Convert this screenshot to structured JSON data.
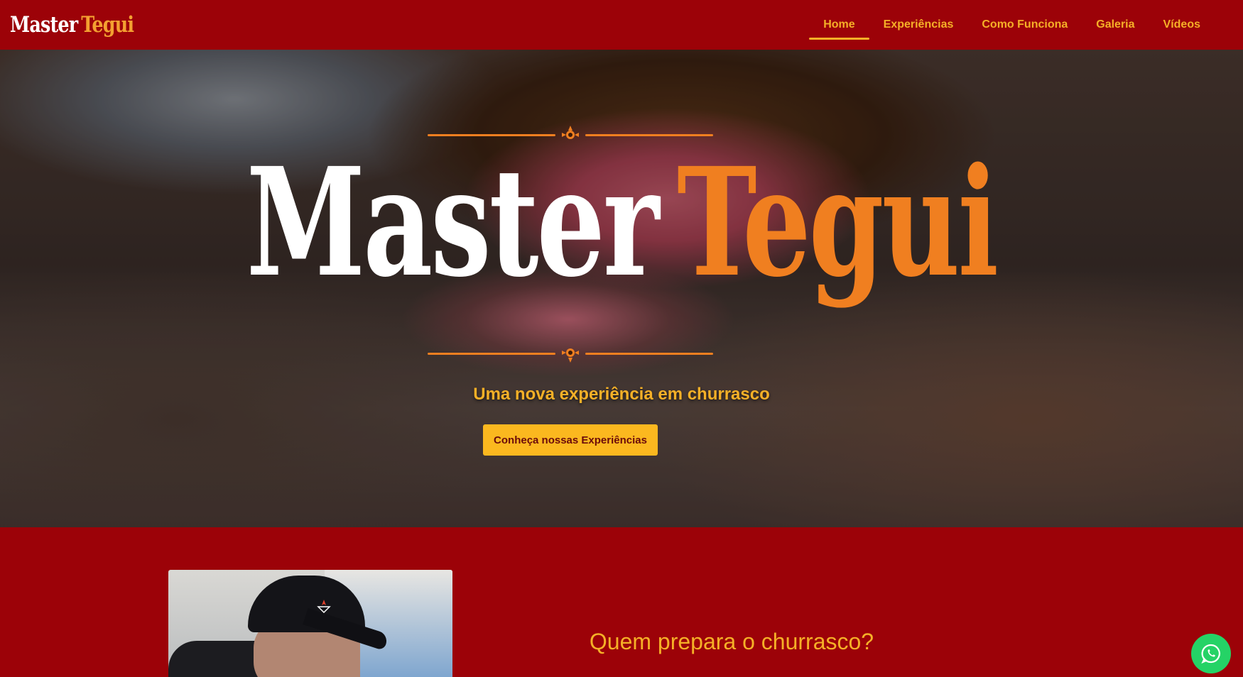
{
  "header": {
    "logo": {
      "word1": "Master",
      "word2": "Tegui"
    },
    "nav": [
      {
        "label": "Home",
        "active": true
      },
      {
        "label": "Experiências",
        "active": false
      },
      {
        "label": "Como Funciona",
        "active": false
      },
      {
        "label": "Galeria",
        "active": false
      },
      {
        "label": "Vídeos",
        "active": false
      }
    ]
  },
  "hero": {
    "title_word1": "Master",
    "title_word2": "Tegui",
    "tagline": "Uma nova experiência em churrasco",
    "cta_label": "Conheça nossas Experiências"
  },
  "about": {
    "title": "Quem prepara o churrasco?"
  },
  "whatsapp": {
    "icon": "whatsapp-icon"
  },
  "colors": {
    "brand_red": "#9c0208",
    "accent_gold": "#f5b027",
    "accent_orange": "#f07f20",
    "cta_yellow": "#fbb81f",
    "whatsapp_green": "#25d366"
  }
}
